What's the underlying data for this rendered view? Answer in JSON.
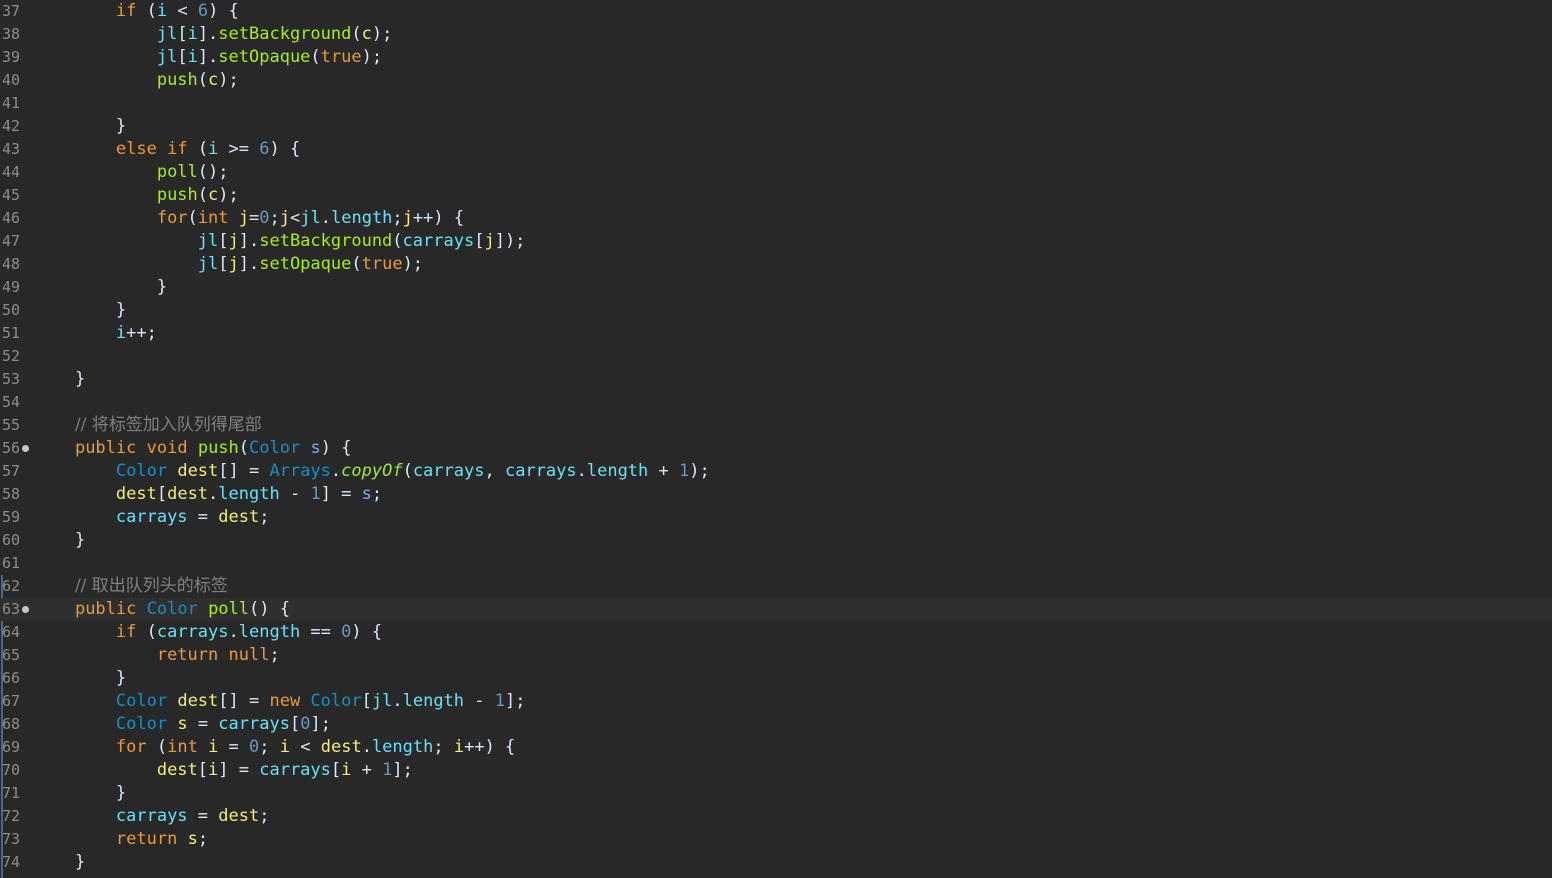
{
  "editor": {
    "language": "Java",
    "theme_colors": {
      "background": "#282828",
      "current_line": "#2f2f2f",
      "keyword": "#e69a3c",
      "method": "#a7ec21",
      "field": "#66e1f8",
      "local_variable": "#f3ec79",
      "parameter": "#79abff",
      "type": "#1290c3",
      "number": "#6897bb",
      "comment": "#808080",
      "static_method": "#96ec3f",
      "line_number": "#8c8c8c"
    },
    "current_line_number": "63",
    "lines": [
      {
        "n": "37",
        "indent": "        ",
        "tokens": [
          {
            "t": "if",
            "c": "kw"
          },
          {
            "t": " (",
            "c": "plain"
          },
          {
            "t": "i",
            "c": "fld"
          },
          {
            "t": " < ",
            "c": "plain"
          },
          {
            "t": "6",
            "c": "num"
          },
          {
            "t": ") {",
            "c": "plain"
          }
        ]
      },
      {
        "n": "38",
        "indent": "            ",
        "tokens": [
          {
            "t": "jl",
            "c": "fld"
          },
          {
            "t": "[",
            "c": "plain"
          },
          {
            "t": "i",
            "c": "fld"
          },
          {
            "t": "].",
            "c": "plain"
          },
          {
            "t": "setBackground",
            "c": "meth"
          },
          {
            "t": "(",
            "c": "plain"
          },
          {
            "t": "c",
            "c": "var"
          },
          {
            "t": ");",
            "c": "plain"
          }
        ]
      },
      {
        "n": "39",
        "indent": "            ",
        "tokens": [
          {
            "t": "jl",
            "c": "fld"
          },
          {
            "t": "[",
            "c": "plain"
          },
          {
            "t": "i",
            "c": "fld"
          },
          {
            "t": "].",
            "c": "plain"
          },
          {
            "t": "setOpaque",
            "c": "meth"
          },
          {
            "t": "(",
            "c": "plain"
          },
          {
            "t": "true",
            "c": "bool"
          },
          {
            "t": ");",
            "c": "plain"
          }
        ]
      },
      {
        "n": "40",
        "indent": "            ",
        "tokens": [
          {
            "t": "push",
            "c": "meth"
          },
          {
            "t": "(",
            "c": "plain"
          },
          {
            "t": "c",
            "c": "var"
          },
          {
            "t": ");",
            "c": "plain"
          }
        ]
      },
      {
        "n": "41",
        "indent": "",
        "tokens": []
      },
      {
        "n": "42",
        "indent": "        ",
        "tokens": [
          {
            "t": "}",
            "c": "plain"
          }
        ]
      },
      {
        "n": "43",
        "indent": "        ",
        "tokens": [
          {
            "t": "else",
            "c": "kw"
          },
          {
            "t": " ",
            "c": "plain"
          },
          {
            "t": "if",
            "c": "kw"
          },
          {
            "t": " (",
            "c": "plain"
          },
          {
            "t": "i",
            "c": "fld"
          },
          {
            "t": " >= ",
            "c": "plain"
          },
          {
            "t": "6",
            "c": "num"
          },
          {
            "t": ") {",
            "c": "plain"
          }
        ]
      },
      {
        "n": "44",
        "indent": "            ",
        "tokens": [
          {
            "t": "poll",
            "c": "meth"
          },
          {
            "t": "();",
            "c": "plain"
          }
        ]
      },
      {
        "n": "45",
        "indent": "            ",
        "tokens": [
          {
            "t": "push",
            "c": "meth"
          },
          {
            "t": "(",
            "c": "plain"
          },
          {
            "t": "c",
            "c": "var"
          },
          {
            "t": ");",
            "c": "plain"
          }
        ]
      },
      {
        "n": "46",
        "indent": "            ",
        "tokens": [
          {
            "t": "for",
            "c": "kw"
          },
          {
            "t": "(",
            "c": "plain"
          },
          {
            "t": "int",
            "c": "kw"
          },
          {
            "t": " ",
            "c": "plain"
          },
          {
            "t": "j",
            "c": "var"
          },
          {
            "t": "=",
            "c": "plain"
          },
          {
            "t": "0",
            "c": "num"
          },
          {
            "t": ";",
            "c": "plain"
          },
          {
            "t": "j",
            "c": "var"
          },
          {
            "t": "<",
            "c": "plain"
          },
          {
            "t": "jl",
            "c": "fld"
          },
          {
            "t": ".",
            "c": "plain"
          },
          {
            "t": "length",
            "c": "fld"
          },
          {
            "t": ";",
            "c": "plain"
          },
          {
            "t": "j",
            "c": "var"
          },
          {
            "t": "++) {",
            "c": "plain"
          }
        ]
      },
      {
        "n": "47",
        "indent": "                ",
        "tokens": [
          {
            "t": "jl",
            "c": "fld"
          },
          {
            "t": "[",
            "c": "plain"
          },
          {
            "t": "j",
            "c": "var"
          },
          {
            "t": "].",
            "c": "plain"
          },
          {
            "t": "setBackground",
            "c": "meth"
          },
          {
            "t": "(",
            "c": "plain"
          },
          {
            "t": "carrays",
            "c": "fld"
          },
          {
            "t": "[",
            "c": "plain"
          },
          {
            "t": "j",
            "c": "var"
          },
          {
            "t": "]);",
            "c": "plain"
          }
        ]
      },
      {
        "n": "48",
        "indent": "                ",
        "tokens": [
          {
            "t": "jl",
            "c": "fld"
          },
          {
            "t": "[",
            "c": "plain"
          },
          {
            "t": "j",
            "c": "var"
          },
          {
            "t": "].",
            "c": "plain"
          },
          {
            "t": "setOpaque",
            "c": "meth"
          },
          {
            "t": "(",
            "c": "plain"
          },
          {
            "t": "true",
            "c": "bool"
          },
          {
            "t": ");",
            "c": "plain"
          }
        ]
      },
      {
        "n": "49",
        "indent": "            ",
        "tokens": [
          {
            "t": "}",
            "c": "plain"
          }
        ]
      },
      {
        "n": "50",
        "indent": "        ",
        "tokens": [
          {
            "t": "}",
            "c": "plain"
          }
        ]
      },
      {
        "n": "51",
        "indent": "        ",
        "tokens": [
          {
            "t": "i",
            "c": "fld"
          },
          {
            "t": "++;",
            "c": "plain"
          }
        ]
      },
      {
        "n": "52",
        "indent": "",
        "tokens": []
      },
      {
        "n": "53",
        "indent": "    ",
        "tokens": [
          {
            "t": "}",
            "c": "plain"
          }
        ]
      },
      {
        "n": "54",
        "indent": "",
        "tokens": []
      },
      {
        "n": "55",
        "indent": "    ",
        "tokens": [
          {
            "t": "// 将标签加入队列得尾部",
            "c": "com"
          }
        ]
      },
      {
        "n": "56",
        "indent": "    ",
        "marker": true,
        "tokens": [
          {
            "t": "public",
            "c": "kw"
          },
          {
            "t": " ",
            "c": "plain"
          },
          {
            "t": "void",
            "c": "kw"
          },
          {
            "t": " ",
            "c": "plain"
          },
          {
            "t": "push",
            "c": "meth"
          },
          {
            "t": "(",
            "c": "plain"
          },
          {
            "t": "Color",
            "c": "type"
          },
          {
            "t": " ",
            "c": "plain"
          },
          {
            "t": "s",
            "c": "param"
          },
          {
            "t": ") {",
            "c": "plain"
          }
        ]
      },
      {
        "n": "57",
        "indent": "        ",
        "tokens": [
          {
            "t": "Color",
            "c": "type"
          },
          {
            "t": " ",
            "c": "plain"
          },
          {
            "t": "dest",
            "c": "var"
          },
          {
            "t": "[] = ",
            "c": "plain"
          },
          {
            "t": "Arrays",
            "c": "type"
          },
          {
            "t": ".",
            "c": "plain"
          },
          {
            "t": "copyOf",
            "c": "static"
          },
          {
            "t": "(",
            "c": "plain"
          },
          {
            "t": "carrays",
            "c": "fld"
          },
          {
            "t": ", ",
            "c": "plain"
          },
          {
            "t": "carrays",
            "c": "fld"
          },
          {
            "t": ".",
            "c": "plain"
          },
          {
            "t": "length",
            "c": "fld"
          },
          {
            "t": " + ",
            "c": "plain"
          },
          {
            "t": "1",
            "c": "num"
          },
          {
            "t": ");",
            "c": "plain"
          }
        ]
      },
      {
        "n": "58",
        "indent": "        ",
        "tokens": [
          {
            "t": "dest",
            "c": "var"
          },
          {
            "t": "[",
            "c": "plain"
          },
          {
            "t": "dest",
            "c": "var"
          },
          {
            "t": ".",
            "c": "plain"
          },
          {
            "t": "length",
            "c": "fld"
          },
          {
            "t": " - ",
            "c": "plain"
          },
          {
            "t": "1",
            "c": "num"
          },
          {
            "t": "] = ",
            "c": "plain"
          },
          {
            "t": "s",
            "c": "param"
          },
          {
            "t": ";",
            "c": "plain"
          }
        ]
      },
      {
        "n": "59",
        "indent": "        ",
        "tokens": [
          {
            "t": "carrays",
            "c": "fld"
          },
          {
            "t": " = ",
            "c": "plain"
          },
          {
            "t": "dest",
            "c": "var"
          },
          {
            "t": ";",
            "c": "plain"
          }
        ]
      },
      {
        "n": "60",
        "indent": "    ",
        "tokens": [
          {
            "t": "}",
            "c": "plain"
          }
        ]
      },
      {
        "n": "61",
        "indent": "",
        "tokens": []
      },
      {
        "n": "62",
        "indent": "    ",
        "tokens": [
          {
            "t": "// 取出队列头的标签",
            "c": "com"
          }
        ]
      },
      {
        "n": "63",
        "indent": "    ",
        "marker": true,
        "current": true,
        "tokens": [
          {
            "t": "public",
            "c": "kw"
          },
          {
            "t": " ",
            "c": "plain"
          },
          {
            "t": "Color",
            "c": "type"
          },
          {
            "t": " ",
            "c": "plain"
          },
          {
            "t": "poll",
            "c": "meth"
          },
          {
            "t": "() {",
            "c": "plain"
          }
        ]
      },
      {
        "n": "64",
        "indent": "        ",
        "tokens": [
          {
            "t": "if",
            "c": "kw"
          },
          {
            "t": " (",
            "c": "plain"
          },
          {
            "t": "carrays",
            "c": "fld"
          },
          {
            "t": ".",
            "c": "plain"
          },
          {
            "t": "length",
            "c": "fld"
          },
          {
            "t": " == ",
            "c": "plain"
          },
          {
            "t": "0",
            "c": "num"
          },
          {
            "t": ") {",
            "c": "plain"
          }
        ]
      },
      {
        "n": "65",
        "indent": "            ",
        "tokens": [
          {
            "t": "return",
            "c": "kw"
          },
          {
            "t": " ",
            "c": "plain"
          },
          {
            "t": "null",
            "c": "kw"
          },
          {
            "t": ";",
            "c": "plain"
          }
        ]
      },
      {
        "n": "66",
        "indent": "        ",
        "tokens": [
          {
            "t": "}",
            "c": "plain"
          }
        ]
      },
      {
        "n": "67",
        "indent": "        ",
        "tokens": [
          {
            "t": "Color",
            "c": "type"
          },
          {
            "t": " ",
            "c": "plain"
          },
          {
            "t": "dest",
            "c": "var"
          },
          {
            "t": "[] = ",
            "c": "plain"
          },
          {
            "t": "new",
            "c": "kw"
          },
          {
            "t": " ",
            "c": "plain"
          },
          {
            "t": "Color",
            "c": "type"
          },
          {
            "t": "[",
            "c": "plain"
          },
          {
            "t": "jl",
            "c": "fld"
          },
          {
            "t": ".",
            "c": "plain"
          },
          {
            "t": "length",
            "c": "fld"
          },
          {
            "t": " - ",
            "c": "plain"
          },
          {
            "t": "1",
            "c": "num"
          },
          {
            "t": "];",
            "c": "plain"
          }
        ]
      },
      {
        "n": "68",
        "indent": "        ",
        "tokens": [
          {
            "t": "Color",
            "c": "type"
          },
          {
            "t": " ",
            "c": "plain"
          },
          {
            "t": "s",
            "c": "var"
          },
          {
            "t": " = ",
            "c": "plain"
          },
          {
            "t": "carrays",
            "c": "fld"
          },
          {
            "t": "[",
            "c": "plain"
          },
          {
            "t": "0",
            "c": "num"
          },
          {
            "t": "];",
            "c": "plain"
          }
        ]
      },
      {
        "n": "69",
        "indent": "        ",
        "tokens": [
          {
            "t": "for",
            "c": "kw"
          },
          {
            "t": " (",
            "c": "plain"
          },
          {
            "t": "int",
            "c": "kw"
          },
          {
            "t": " ",
            "c": "plain"
          },
          {
            "t": "i",
            "c": "var"
          },
          {
            "t": " = ",
            "c": "plain"
          },
          {
            "t": "0",
            "c": "num"
          },
          {
            "t": "; ",
            "c": "plain"
          },
          {
            "t": "i",
            "c": "var"
          },
          {
            "t": " < ",
            "c": "plain"
          },
          {
            "t": "dest",
            "c": "var"
          },
          {
            "t": ".",
            "c": "plain"
          },
          {
            "t": "length",
            "c": "fld"
          },
          {
            "t": "; ",
            "c": "plain"
          },
          {
            "t": "i",
            "c": "var"
          },
          {
            "t": "++) {",
            "c": "plain"
          }
        ]
      },
      {
        "n": "70",
        "indent": "            ",
        "tokens": [
          {
            "t": "dest",
            "c": "var"
          },
          {
            "t": "[",
            "c": "plain"
          },
          {
            "t": "i",
            "c": "var"
          },
          {
            "t": "] = ",
            "c": "plain"
          },
          {
            "t": "carrays",
            "c": "fld"
          },
          {
            "t": "[",
            "c": "plain"
          },
          {
            "t": "i",
            "c": "var"
          },
          {
            "t": " + ",
            "c": "plain"
          },
          {
            "t": "1",
            "c": "num"
          },
          {
            "t": "];",
            "c": "plain"
          }
        ]
      },
      {
        "n": "71",
        "indent": "        ",
        "tokens": [
          {
            "t": "}",
            "c": "plain"
          }
        ]
      },
      {
        "n": "72",
        "indent": "        ",
        "tokens": [
          {
            "t": "carrays",
            "c": "fld"
          },
          {
            "t": " = ",
            "c": "plain"
          },
          {
            "t": "dest",
            "c": "var"
          },
          {
            "t": ";",
            "c": "plain"
          }
        ]
      },
      {
        "n": "73",
        "indent": "        ",
        "tokens": [
          {
            "t": "return",
            "c": "kw"
          },
          {
            "t": " ",
            "c": "plain"
          },
          {
            "t": "s",
            "c": "var"
          },
          {
            "t": ";",
            "c": "plain"
          }
        ]
      },
      {
        "n": "74",
        "indent": "    ",
        "tokens": [
          {
            "t": "}",
            "c": "plain"
          }
        ]
      }
    ]
  }
}
